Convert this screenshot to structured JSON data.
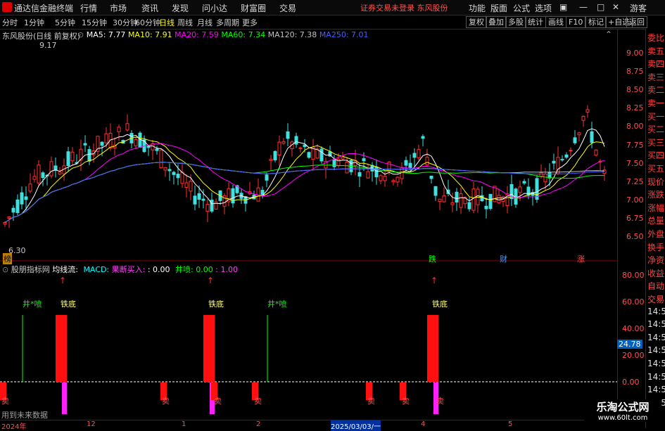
{
  "menubar": {
    "app_title": "通达信金融终端",
    "menus": [
      "行情",
      "市场",
      "资讯",
      "发现",
      "问小达",
      "财富圈",
      "交易"
    ],
    "notice": "证券交易未登录  东风股份",
    "right_menus": [
      "功能",
      "版面",
      "公式",
      "选项"
    ],
    "guest": "游客"
  },
  "toolbar": {
    "periods": [
      "分时",
      "1分钟",
      "5分钟",
      "15分钟",
      "30分钟",
      "60分钟",
      "日线",
      "周线",
      "月线",
      "多周期",
      "更多"
    ],
    "active_period": "日线",
    "buttons": [
      "复权",
      "叠加",
      "多股",
      "统计",
      "画线",
      "F10",
      "标记",
      "+自选",
      "返回"
    ]
  },
  "main_chart": {
    "title": "东风股份(日线 前复权)",
    "ma_labels": [
      {
        "text": "MA5: 7.77",
        "color": "#ffffff"
      },
      {
        "text": "MA10: 7.91",
        "color": "#ffff00"
      },
      {
        "text": "MA20: 7.59",
        "color": "#ff00ff"
      },
      {
        "text": "MA60: 7.34",
        "color": "#00ff00"
      },
      {
        "text": "MA120: 7.38",
        "color": "#c0c0c0"
      },
      {
        "text": "MA250: 7.01",
        "color": "#4060ff"
      }
    ],
    "high_label": "9.17",
    "low_label": "6.30",
    "y_ticks": [
      "9.00",
      "8.75",
      "8.50",
      "8.25",
      "8.00",
      "7.75",
      "7.50",
      "7.25",
      "7.00",
      "6.75",
      "6.50"
    ],
    "event_markers": [
      "榜",
      "跌",
      "财",
      "涨"
    ]
  },
  "indicator": {
    "title": "股朋指标网",
    "sub": "均线流:",
    "macd_label": "MACD:",
    "buy_label": "果断买入:",
    "buy_value": ": 0.00",
    "jing_label": "井喷: 0.00",
    "jing_value": ": 1.00",
    "signals": [
      "井*喷",
      "铁底",
      "铁底",
      "井*喷",
      "铁底"
    ],
    "y_ticks": [
      "80.00",
      "60.00",
      "40.00",
      "20.00",
      "0.00"
    ],
    "current_value": "24.78",
    "future_note": "用到未来数据",
    "sell_marks": [
      "卖",
      "卖",
      "卖",
      "卖",
      "卖",
      "卖",
      "卖"
    ]
  },
  "right_panel": {
    "items": [
      "委比",
      "卖五",
      "卖四",
      "卖三",
      "卖二",
      "卖一",
      "买一",
      "买二",
      "买三",
      "买四",
      "买五",
      "现价",
      "涨跌",
      "涨幅",
      "总量",
      "外盘",
      "换手",
      "净资",
      "收益",
      "自动",
      "交易",
      "14:5",
      "14:5",
      "14:5",
      "14:5",
      "14:5",
      "14:5",
      "14:5",
      "14:5"
    ]
  },
  "statusbar": {
    "labels": [
      "2024年",
      "12",
      "1",
      "2",
      "2025/03/03/一",
      "4",
      "5"
    ]
  },
  "watermark": {
    "title": "乐淘公式网",
    "url": "www.60lt.com"
  }
}
